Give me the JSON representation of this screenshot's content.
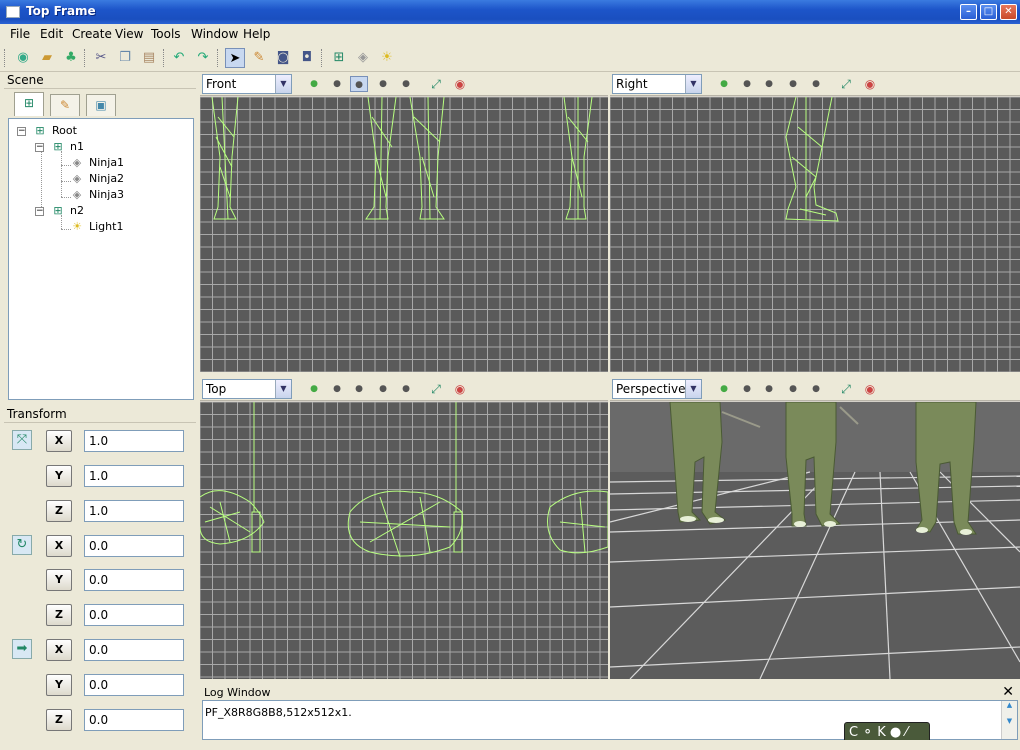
{
  "window": {
    "title": "Top Frame",
    "minimize": "–",
    "maximize": "□",
    "close": "✕"
  },
  "menu": [
    "File",
    "Edit",
    "Create",
    "View",
    "Tools",
    "Window",
    "Help"
  ],
  "scene": {
    "title": "Scene",
    "tree": [
      {
        "label": "Root",
        "type": "group"
      },
      {
        "label": "n1",
        "type": "group"
      },
      {
        "label": "Ninja1",
        "type": "mesh"
      },
      {
        "label": "Ninja2",
        "type": "mesh"
      },
      {
        "label": "Ninja3",
        "type": "mesh"
      },
      {
        "label": "n2",
        "type": "group"
      },
      {
        "label": "Light1",
        "type": "light"
      }
    ]
  },
  "transform": {
    "title": "Transform",
    "rows": [
      {
        "axis": "X",
        "value": "1.0"
      },
      {
        "axis": "Y",
        "value": "1.0"
      },
      {
        "axis": "Z",
        "value": "1.0"
      },
      {
        "axis": "X",
        "value": "0.0"
      },
      {
        "axis": "Y",
        "value": "0.0"
      },
      {
        "axis": "Z",
        "value": "0.0"
      },
      {
        "axis": "X",
        "value": "0.0"
      },
      {
        "axis": "Y",
        "value": "0.0"
      },
      {
        "axis": "Z",
        "value": "0.0"
      }
    ]
  },
  "viewports": [
    {
      "view": "Front"
    },
    {
      "view": "Right"
    },
    {
      "view": "Top"
    },
    {
      "view": "Perspective"
    }
  ],
  "log": {
    "title": "Log Window",
    "text": "PF_X8R8G8B8,512x512x1."
  },
  "tray": {
    "text": "C ⚬ K ● ⁄"
  },
  "colors": {
    "wire": "#b8ff80",
    "grid_bg": "#5a5a5a",
    "grid_line": "#a8a8a8",
    "title_bar": "#1d55c9"
  }
}
